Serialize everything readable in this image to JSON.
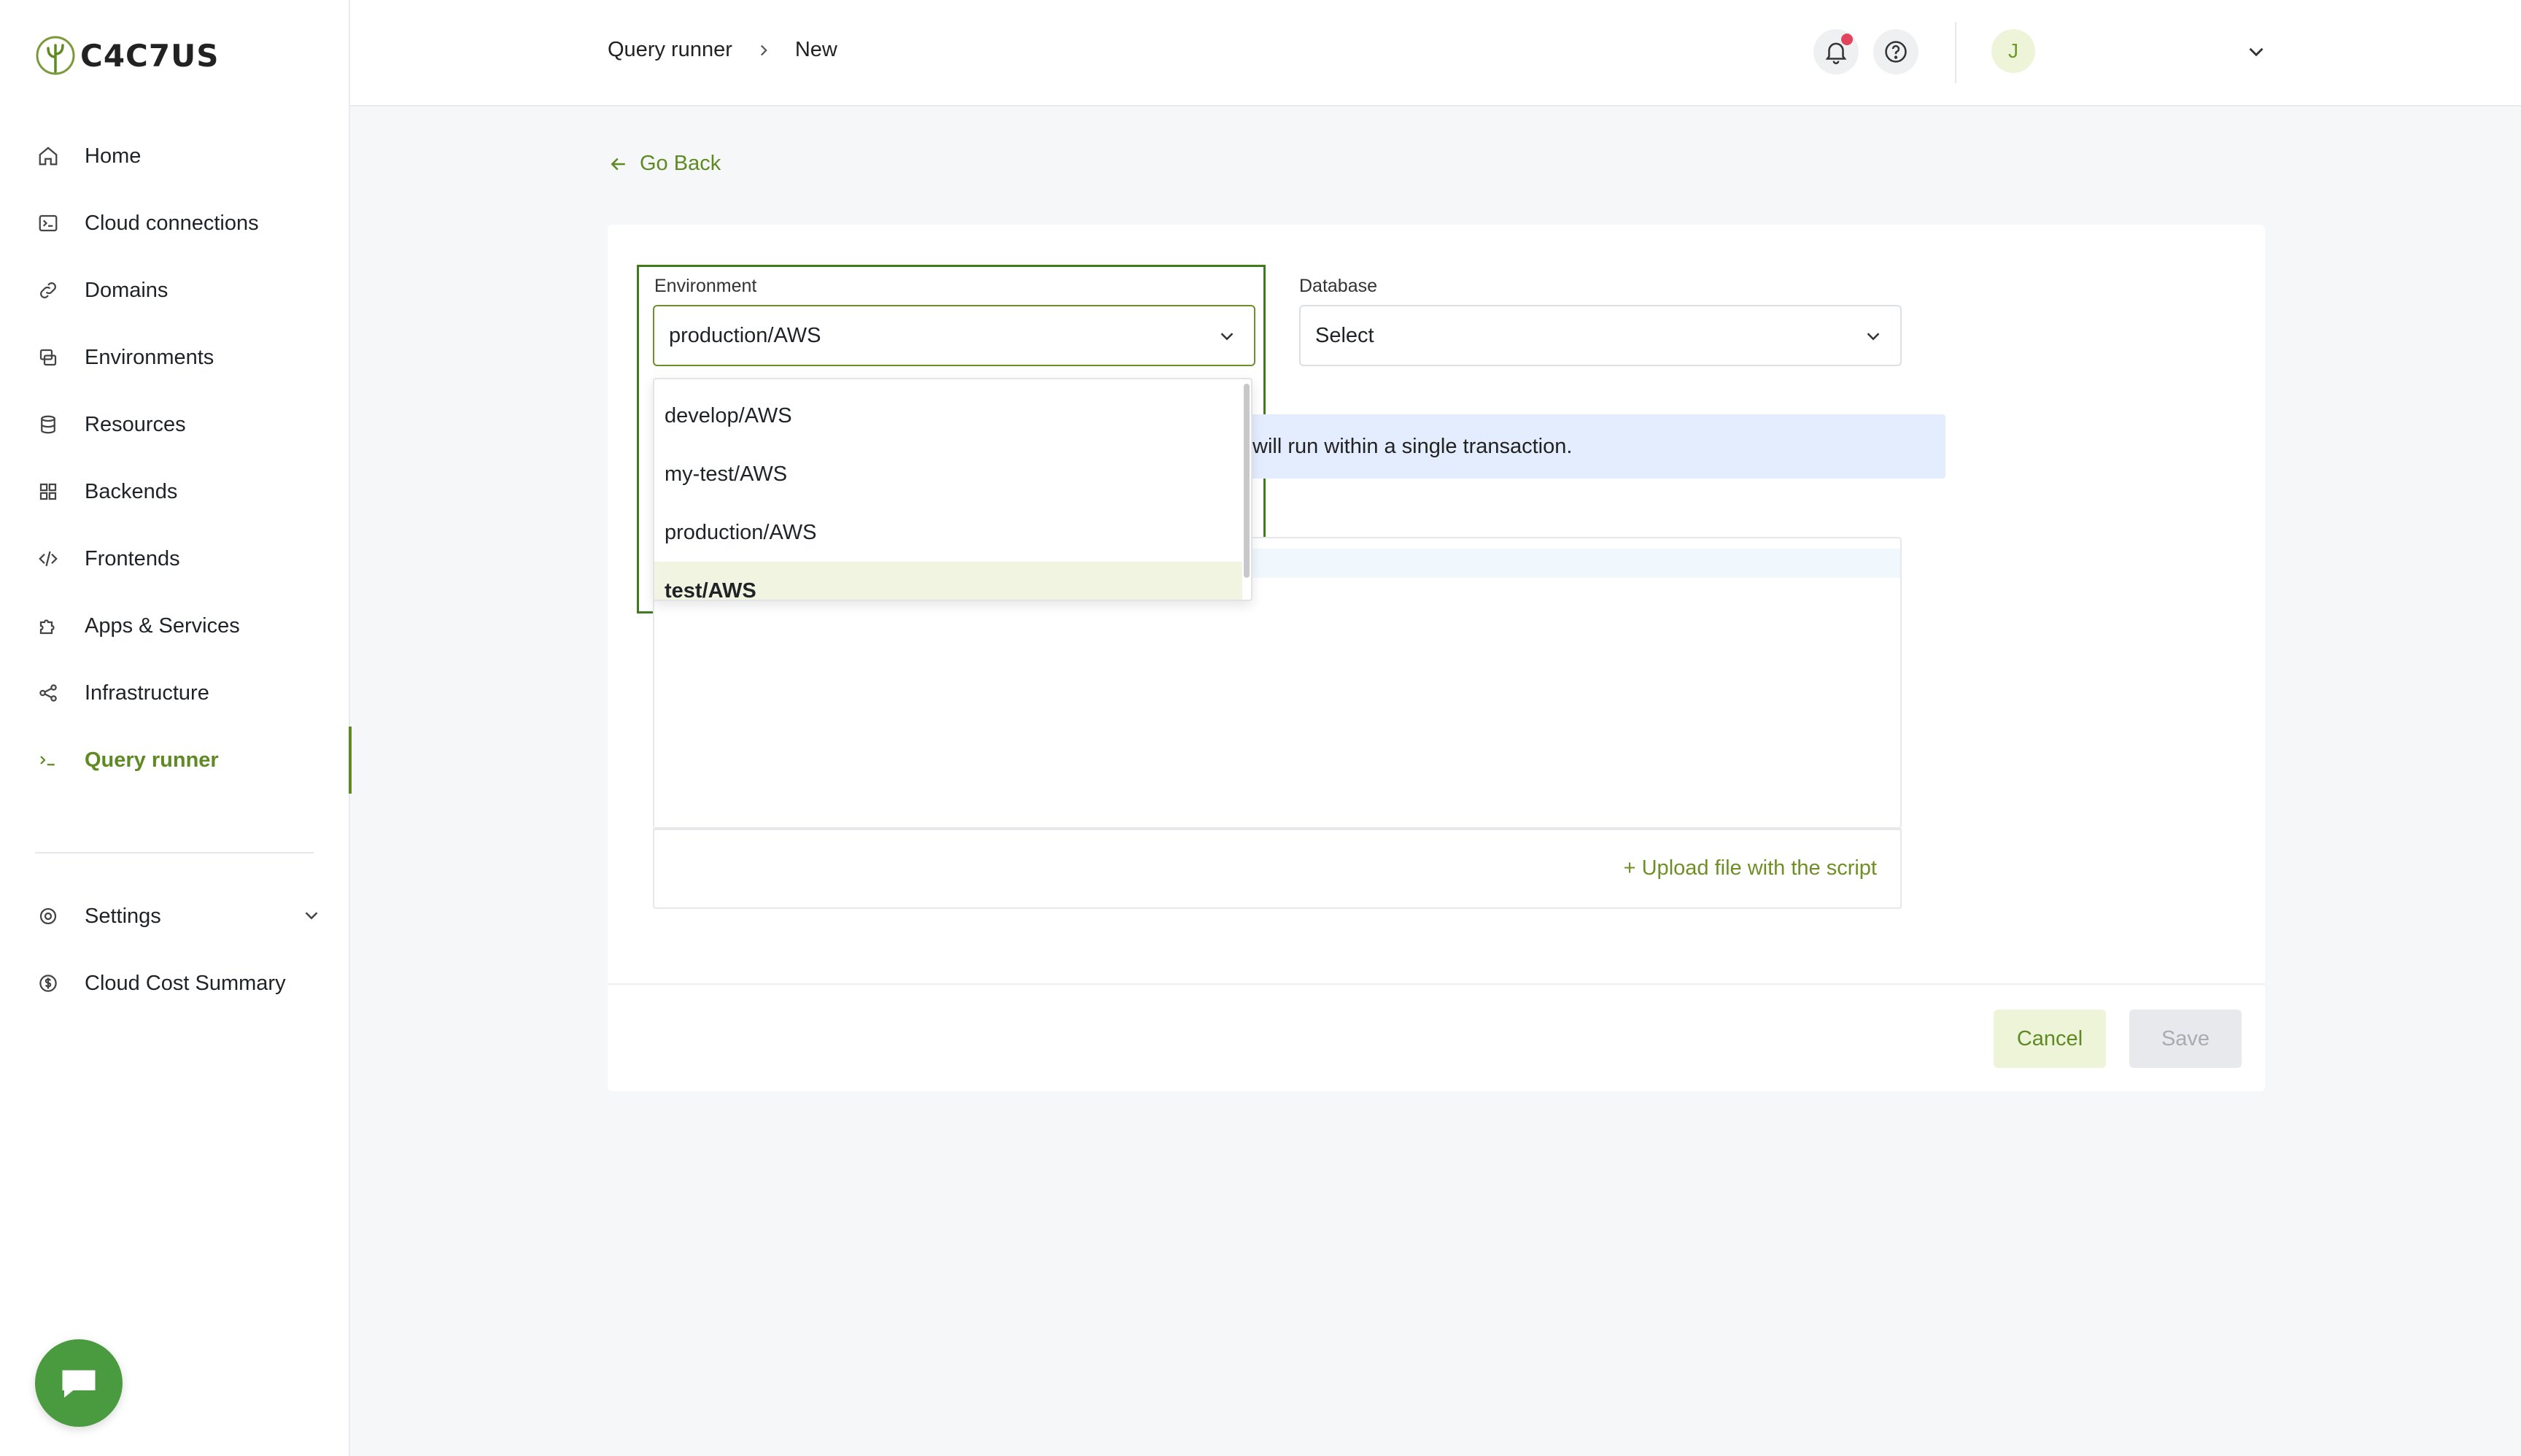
{
  "app": {
    "brand": "C4C7US"
  },
  "sidebar": {
    "items": [
      {
        "label": "Home",
        "icon": "home-icon"
      },
      {
        "label": "Cloud connections",
        "icon": "terminal-square-icon"
      },
      {
        "label": "Domains",
        "icon": "link-icon"
      },
      {
        "label": "Environments",
        "icon": "environments-icon"
      },
      {
        "label": "Resources",
        "icon": "database-icon"
      },
      {
        "label": "Backends",
        "icon": "grid-icon"
      },
      {
        "label": "Frontends",
        "icon": "code-icon"
      },
      {
        "label": "Apps & Services",
        "icon": "puzzle-icon"
      },
      {
        "label": "Infrastructure",
        "icon": "share-nodes-icon"
      },
      {
        "label": "Query runner",
        "icon": "terminal-prompt-icon",
        "active": true
      }
    ],
    "bottom_items": [
      {
        "label": "Settings",
        "icon": "gear-icon"
      },
      {
        "label": "Cloud Cost Summary",
        "icon": "dollar-circle-icon"
      }
    ]
  },
  "header": {
    "breadcrumb": [
      "Query runner",
      "New"
    ],
    "avatar_initial": "J"
  },
  "main": {
    "go_back_label": "Go Back",
    "environment": {
      "label": "Environment",
      "value": "production/AWS",
      "options": [
        "develop/AWS",
        "my-test/AWS",
        "production/AWS",
        "test/AWS"
      ],
      "highlighted_option": "test/AWS"
    },
    "database": {
      "label": "Database",
      "value": "Select"
    },
    "info_banner_text": "will run within a single transaction.",
    "upload_link": "+ Upload file with the script",
    "cancel_label": "Cancel",
    "save_label": "Save"
  },
  "colors": {
    "accent": "#5f8a23",
    "chat_button": "#4a9a3f",
    "info_banner_bg": "#e3edfd",
    "notification_dot": "#e2445c"
  }
}
